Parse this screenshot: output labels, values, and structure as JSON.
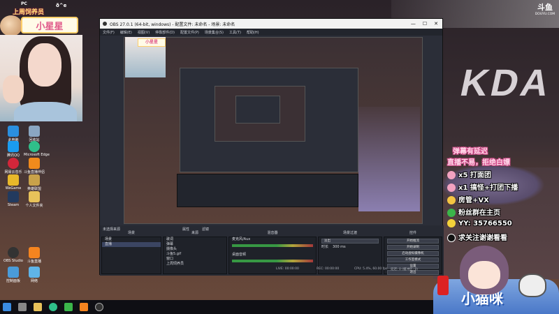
{
  "overlay": {
    "badge_pc": "PC",
    "badge_rank": "上周饲养员",
    "badge_id": "ð^e",
    "nickname": "小星星"
  },
  "desktop_icons": [
    {
      "label": "此电脑"
    },
    {
      "label": "回收站"
    },
    {
      "label": "腾讯QQ"
    },
    {
      "label": "Microsoft Edge"
    },
    {
      "label": "网易云音乐"
    },
    {
      "label": "斗鱼直播伴侣"
    },
    {
      "label": "WeGame"
    },
    {
      "label": "英雄联盟"
    },
    {
      "label": "Steam"
    },
    {
      "label": "个人文件夹"
    },
    {
      "label": "OBS Studio"
    },
    {
      "label": "斗鱼直播"
    },
    {
      "label": "控制面板"
    },
    {
      "label": "网络"
    }
  ],
  "obs": {
    "title": "OBS 27.0.1 (64-bit, windows) - 配置文件: 未命名 - 场景: 未命名",
    "menu": [
      "文件(F)",
      "编辑(E)",
      "视图(V)",
      "停靠部件(D)",
      "配置文件(P)",
      "场景集合(S)",
      "工具(T)",
      "帮助(H)"
    ],
    "window_controls": [
      "—",
      "☐",
      "✕"
    ],
    "preview_nickname": "小星星",
    "docks": {
      "scenes": {
        "title": "场景",
        "items": [
          "场景",
          "直播"
        ]
      },
      "sources": {
        "title": "来源",
        "items": [
          "歌词",
          "弹幕",
          "摄像头",
          "斗鱼5.gif",
          "窗口",
          "上周饲养员"
        ]
      },
      "mixer": {
        "title": "混音器",
        "tracks": [
          "麦克风/Aux",
          "桌面音频"
        ]
      },
      "transitions": {
        "title": "场景过渡",
        "fade_label": "淡出",
        "duration_label": "时长",
        "duration": "300 ms"
      },
      "controls": {
        "title": "控件",
        "buttons": [
          "开始推流",
          "开始录制",
          "启动虚拟摄像机",
          "工作室模式",
          "设置",
          "退出"
        ]
      }
    },
    "selected_source": "未选择来源",
    "attribute_label": "属性",
    "filter_label": "滤镜",
    "status": {
      "live": "LIVE: 00:00:00",
      "rec": "REC: 00:00:00",
      "cpu": "CPU: 5.4%, 60.00 fps",
      "noti": "延迟: 0 (缓冲区: 0)"
    }
  },
  "right_overlay": {
    "line1": "弹幕有延迟",
    "line2": "直播不易，拒绝白嫖",
    "line3": "x5 打面团",
    "line4": "x1 搞怪+打团下播",
    "line5": "房管+VX",
    "line6": "粉丝群在主页",
    "line7": "YY: 35766550",
    "line8": "求关注谢谢看看",
    "sofa_text": "小猫咪"
  },
  "watermark": {
    "logo": "斗鱼",
    "url": "DOUYU.COM"
  },
  "colors": {
    "accent_pink": "#e05a8a",
    "obs_bg": "#2b2e38",
    "overlay_pink": "#d44a8a"
  }
}
